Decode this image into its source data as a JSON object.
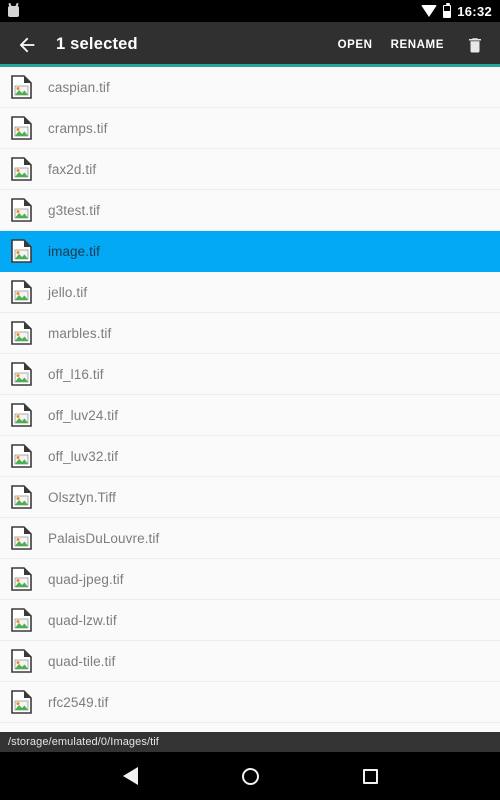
{
  "status_bar": {
    "notification_icon": "notification-icon",
    "wifi_icon": "wifi-icon",
    "battery_icon": "battery-icon",
    "time": "16:32"
  },
  "toolbar": {
    "back_icon": "back-arrow-icon",
    "title": "1 selected",
    "open_label": "OPEN",
    "rename_label": "RENAME",
    "delete_icon": "trash-icon",
    "background_color": "#303030",
    "accent_color": "#26a69a"
  },
  "file_list": {
    "selected_color": "#03a9f4",
    "items": [
      {
        "name": "caspian.tif",
        "selected": false
      },
      {
        "name": "cramps.tif",
        "selected": false
      },
      {
        "name": "fax2d.tif",
        "selected": false
      },
      {
        "name": "g3test.tif",
        "selected": false
      },
      {
        "name": "image.tif",
        "selected": true
      },
      {
        "name": "jello.tif",
        "selected": false
      },
      {
        "name": "marbles.tif",
        "selected": false
      },
      {
        "name": "off_l16.tif",
        "selected": false
      },
      {
        "name": "off_luv24.tif",
        "selected": false
      },
      {
        "name": "off_luv32.tif",
        "selected": false
      },
      {
        "name": "Olsztyn.Tiff",
        "selected": false
      },
      {
        "name": "PalaisDuLouvre.tif",
        "selected": false
      },
      {
        "name": "quad-jpeg.tif",
        "selected": false
      },
      {
        "name": "quad-lzw.tif",
        "selected": false
      },
      {
        "name": "quad-tile.tif",
        "selected": false
      },
      {
        "name": "rfc2549.tif",
        "selected": false
      }
    ]
  },
  "path_bar": {
    "path": "/storage/emulated/0/Images/tif"
  },
  "nav_bar": {
    "back_icon": "nav-back-icon",
    "home_icon": "nav-home-icon",
    "recents_icon": "nav-recents-icon"
  }
}
